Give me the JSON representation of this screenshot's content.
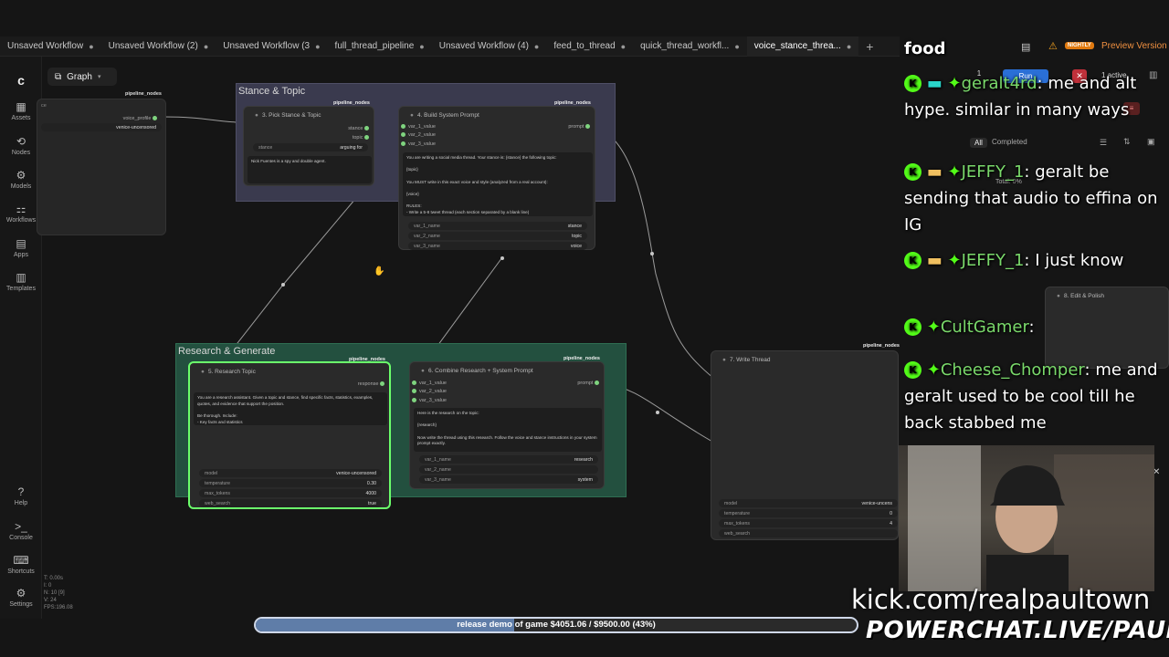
{
  "tabs": [
    {
      "label": "Unsaved Workflow"
    },
    {
      "label": "Unsaved Workflow (2)"
    },
    {
      "label": "Unsaved Workflow (3"
    },
    {
      "label": "full_thread_pipeline"
    },
    {
      "label": "Unsaved Workflow (4)"
    },
    {
      "label": "feed_to_thread"
    },
    {
      "label": "quick_thread_workfl..."
    },
    {
      "label": "voice_stance_threa...",
      "active": true
    }
  ],
  "header_right": {
    "nightly": "NIGHTLY",
    "preview": "Preview Version",
    "run": "Run",
    "active": "1 active",
    "queue_count": "1"
  },
  "graph_button": "Graph",
  "sidebar": [
    {
      "icon": "assets-icon",
      "label": "Assets"
    },
    {
      "icon": "nodes-icon",
      "label": "Nodes"
    },
    {
      "icon": "models-icon",
      "label": "Models"
    },
    {
      "icon": "workflows-icon",
      "label": "Workflows"
    },
    {
      "icon": "apps-icon",
      "label": "Apps"
    },
    {
      "icon": "templates-icon",
      "label": "Templates"
    },
    {
      "icon": "help-icon",
      "label": "Help"
    },
    {
      "icon": "console-icon",
      "label": "Console"
    },
    {
      "icon": "shortcuts-icon",
      "label": "Shortcuts"
    },
    {
      "icon": "settings-icon",
      "label": "Settings"
    }
  ],
  "stats": [
    "T: 0.00s",
    "I: 0",
    "N: 10 [9]",
    "V: 24",
    "FPS:196.08"
  ],
  "queue_panel": {
    "tab_all": "All",
    "tab_completed": "Completed",
    "total": "Total: 0%"
  },
  "groups": {
    "stance_topic": {
      "title": "Stance & Topic"
    },
    "research_generate": {
      "title": "Research & Generate"
    }
  },
  "nodes": {
    "partial_left": {
      "badge": "pipeline_nodes",
      "output": "voice_profile",
      "value": "venice-uncensored"
    },
    "pick_stance": {
      "title": "3. Pick Stance & Topic",
      "badge": "pipeline_nodes",
      "out1": "stance",
      "out2": "topic",
      "widget_label": "stance",
      "widget_value": "arguing for",
      "text": "Nick Fuentes is a spy and double agent."
    },
    "build_prompt": {
      "title": "4. Build System Prompt",
      "badge": "pipeline_nodes",
      "in1": "var_1_value",
      "in2": "var_2_value",
      "in3": "var_3_value",
      "out": "prompt",
      "text": "You are writing a social media thread. Your stance is: {stance} the following topic:\n\n{topic}\n\nYou MUST write in this exact voice and style (analyzed from a real account):\n\n{voice}\n\nRULES:\n- Write a 5-8 tweet thread (each section separated by a blank line)",
      "w1_label": "var_1_name",
      "w1_value": "stance",
      "w2_label": "var_2_name",
      "w2_value": "topic",
      "w3_label": "var_3_name",
      "w3_value": "voice"
    },
    "research_topic": {
      "title": "5. Research Topic",
      "badge": "pipeline_nodes",
      "out": "response",
      "text": "You are a research assistant. Given a topic and stance, find specific facts, statistics, examples, quotes, and evidence that support the position.\n\nBe thorough. Include:\n- Key facts and statistics",
      "w1_label": "model",
      "w1_value": "venice-uncensored",
      "w2_label": "temperature",
      "w2_value": "0.30",
      "w3_label": "max_tokens",
      "w3_value": "4000",
      "w4_label": "web_search",
      "w4_value": "true"
    },
    "combine": {
      "title": "6. Combine Research + System Prompt",
      "badge": "pipeline_nodes",
      "in1": "var_1_value",
      "in2": "var_2_value",
      "in3": "var_3_value",
      "out": "prompt",
      "text": "Here is the research on the topic:\n\n{research}\n\nNow write the thread using this research. Follow the voice and stance instructions in your system prompt exactly.\n\nSystem instructions:",
      "w1_label": "var_1_name",
      "w1_value": "research",
      "w2_label": "var_2_name",
      "w2_value": "",
      "w3_label": "var_3_name",
      "w3_value": "system"
    },
    "write_thread": {
      "title": "7. Write Thread",
      "badge": "pipeline_nodes",
      "w1_label": "model",
      "w1_value": "venice-uncens",
      "w2_label": "temperature",
      "w2_value": "0",
      "w3_label": "max_tokens",
      "w3_value": "4",
      "w4_label": "web_search",
      "w4_value": ""
    },
    "edit_polish": {
      "title": "8. Edit & Polish"
    }
  },
  "chat": [
    {
      "user": "food",
      "message": ""
    },
    {
      "user": "geralt4rd",
      "message": "me and alt hype. similar in many ways"
    },
    {
      "user": "JEFFY_1",
      "message": "geralt be sending that audio to effina on IG"
    },
    {
      "user": "JEFFY_1",
      "message": "I just know"
    },
    {
      "user": "CultGamer",
      "message": ""
    },
    {
      "user": "Cheese_Chomper",
      "message": "me and geralt used to be cool till he back stabbed me"
    }
  ],
  "goal": {
    "text": "release demo of game $4051.06 / $9500.00 (43%)",
    "progress": 0.43
  },
  "overlay": {
    "kick_url": "kick.com/realpaultown",
    "powerchat": "POWERCHAT.LIVE/PAULTOWN"
  },
  "colors": {
    "accent_green": "#53fc18",
    "group_stance": "#4a4a66",
    "group_research": "#2f6e52",
    "selected_node": "#6bff6b"
  }
}
